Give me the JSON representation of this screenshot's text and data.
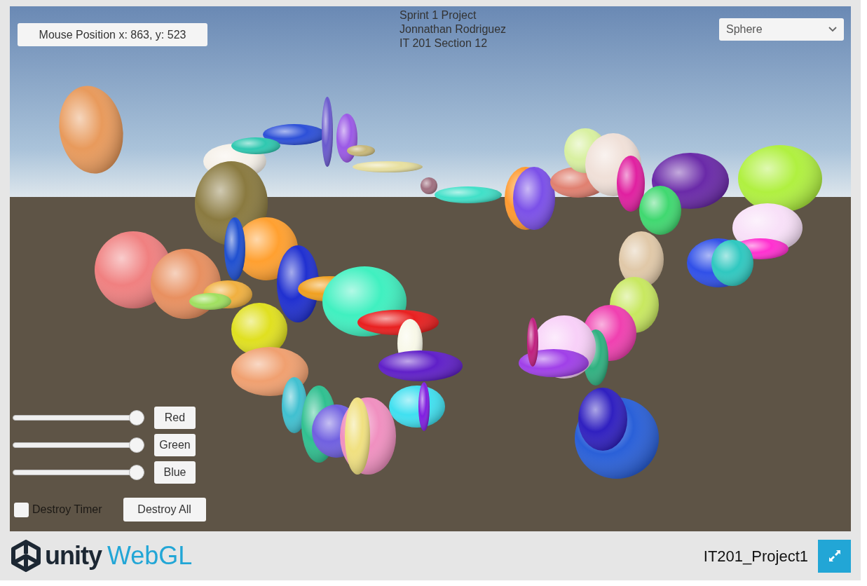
{
  "canvas": {
    "mouse_position": "Mouse Position x: 863, y: 523",
    "info_lines": [
      "Sprint 1 Project",
      "Jonnathan Rodriguez",
      "IT 201 Section 12"
    ],
    "shape_dropdown": {
      "value": "Sphere"
    },
    "color_sliders": [
      {
        "label": "Red",
        "level": 1
      },
      {
        "label": "Green",
        "level": 1
      },
      {
        "label": "Blue",
        "level": 1
      }
    ],
    "destroy_timer": {
      "label": "Destroy Timer",
      "checked": false
    },
    "destroy_all_button": "Destroy All"
  },
  "footer": {
    "logo_word": "unity",
    "logo_product": "WebGL",
    "project_title": "IT201_Project1"
  }
}
